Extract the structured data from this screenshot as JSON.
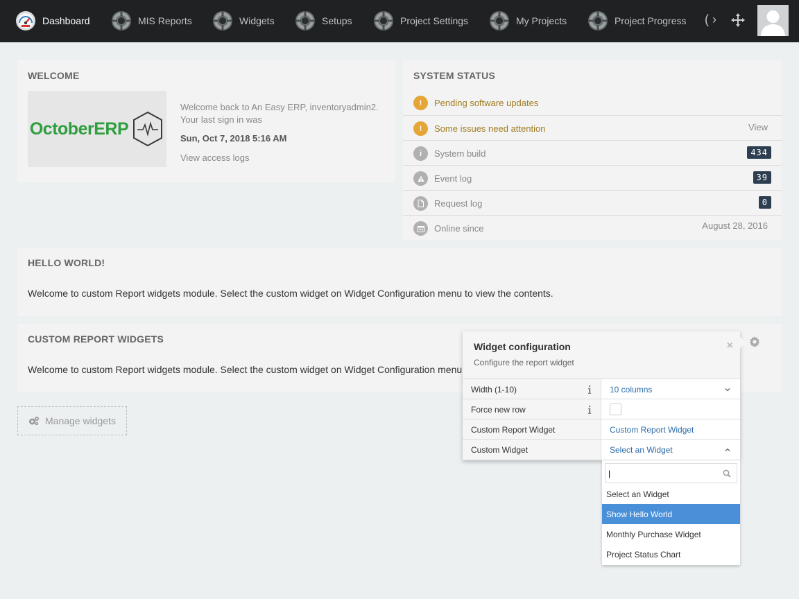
{
  "nav": {
    "items": [
      {
        "label": "Dashboard",
        "icon": "speedometer-icon"
      },
      {
        "label": "MIS Reports",
        "icon": "lifebuoy-icon"
      },
      {
        "label": "Widgets",
        "icon": "lifebuoy-icon"
      },
      {
        "label": "Setups",
        "icon": "lifebuoy-icon"
      },
      {
        "label": "Project Settings",
        "icon": "lifebuoy-icon"
      },
      {
        "label": "My Projects",
        "icon": "lifebuoy-icon"
      },
      {
        "label": "Project Progress",
        "icon": "lifebuoy-icon"
      }
    ],
    "overflow": "( ›"
  },
  "welcome": {
    "title": "WELCOME",
    "logo_text": "OctoberERP",
    "message": "Welcome back to An Easy ERP, inventoryadmin2. Your last sign in was",
    "last_signin": "Sun, Oct 7, 2018 5:16 AM",
    "access_logs_link": "View access logs"
  },
  "system_status": {
    "title": "SYSTEM STATUS",
    "rows": [
      {
        "label": "Pending software updates",
        "icon": "exclamation-icon",
        "value": ""
      },
      {
        "label": "Some issues need attention",
        "icon": "exclamation-icon",
        "value": "View"
      },
      {
        "label": "System build",
        "icon": "info-icon",
        "value": "434"
      },
      {
        "label": "Event log",
        "icon": "warning-icon",
        "value": "39"
      },
      {
        "label": "Request log",
        "icon": "file-icon",
        "value": "0"
      },
      {
        "label": "Online since",
        "icon": "calendar-icon",
        "value": "August 28, 2016"
      }
    ]
  },
  "hello": {
    "title": "HELLO WORLD!",
    "body": "Welcome to custom Report widgets module. Select the custom widget on Widget Configuration menu to view the contents."
  },
  "custom": {
    "title": "CUSTOM REPORT WIDGETS",
    "body": "Welcome to custom Report widgets module. Select the custom widget on Widget Configuration menu"
  },
  "manage_widgets": "Manage widgets",
  "popover": {
    "title": "Widget configuration",
    "subtitle": "Configure the report widget",
    "close": "×",
    "rows": [
      {
        "label": "Width (1-10)",
        "value": "10 columns"
      },
      {
        "label": "Force new row",
        "value": ""
      },
      {
        "label": "Custom Report Widget",
        "value": "Custom Report Widget"
      },
      {
        "label": "Custom Widget",
        "value": "Select an Widget"
      }
    ]
  },
  "dropdown": {
    "search_value": "|",
    "options": [
      "Select an Widget",
      "Show Hello World",
      "Monthly Purchase Widget",
      "Project Status Chart"
    ],
    "highlighted": "Show Hello World"
  },
  "colors": {
    "topbar": "#1f2122",
    "warning": "#e5a637",
    "badge": "#2c3e50",
    "highlight": "#4a90d9",
    "logo_green": "#2e9e3f"
  }
}
